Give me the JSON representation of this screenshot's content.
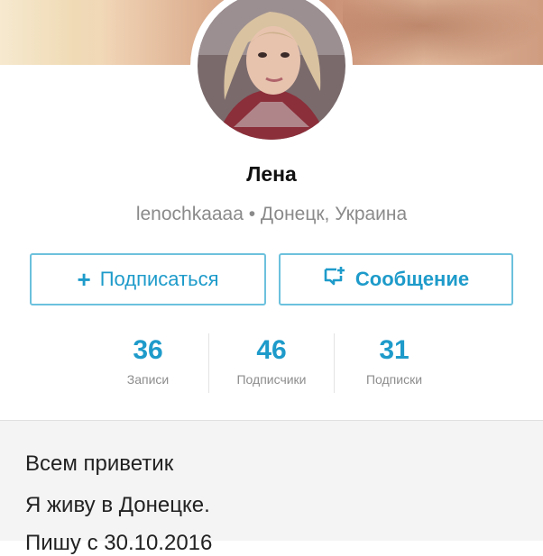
{
  "profile": {
    "name": "Лена",
    "meta": "lenochkaaaa • Донецк, Украина"
  },
  "buttons": {
    "follow_icon": "plus-icon",
    "follow_label": "Подписаться",
    "message_icon": "message-add-icon",
    "message_label": "Сообщение"
  },
  "stats": [
    {
      "value": "36",
      "label": "Записи"
    },
    {
      "value": "46",
      "label": "Подписчики"
    },
    {
      "value": "31",
      "label": "Подписки"
    }
  ],
  "about": {
    "lines": [
      "Всем приветик",
      "Я живу в Донецке.",
      "Пишу с 30.10.2016"
    ]
  },
  "colors": {
    "accent": "#1e9bca",
    "button_border": "#6cc1dd",
    "about_bg": "#f4f4f4"
  }
}
